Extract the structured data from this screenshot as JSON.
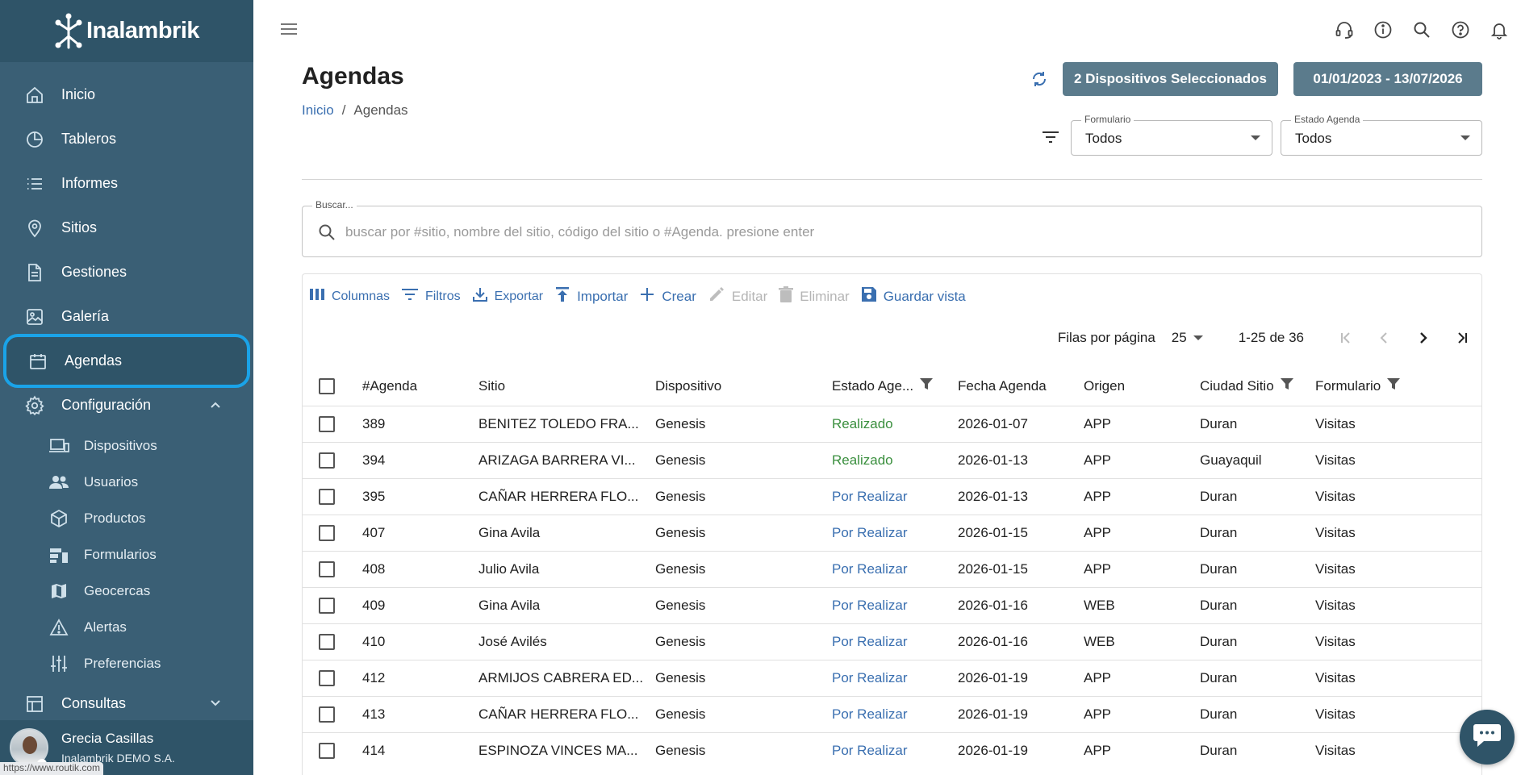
{
  "app": {
    "name": "Inalambrik"
  },
  "sidebar": {
    "items": [
      {
        "label": "Inicio",
        "icon": "home-icon"
      },
      {
        "label": "Tableros",
        "icon": "pie-chart-icon"
      },
      {
        "label": "Informes",
        "icon": "list-icon"
      },
      {
        "label": "Sitios",
        "icon": "location-pin-icon"
      },
      {
        "label": "Gestiones",
        "icon": "document-icon"
      },
      {
        "label": "Galería",
        "icon": "image-icon"
      },
      {
        "label": "Agendas",
        "icon": "calendar-icon",
        "active": true
      },
      {
        "label": "Configuración",
        "icon": "gear-icon",
        "expanded": true
      }
    ],
    "config_items": [
      {
        "label": "Dispositivos",
        "icon": "devices-icon"
      },
      {
        "label": "Usuarios",
        "icon": "users-icon"
      },
      {
        "label": "Productos",
        "icon": "box-icon"
      },
      {
        "label": "Formularios",
        "icon": "form-icon"
      },
      {
        "label": "Geocercas",
        "icon": "map-icon"
      },
      {
        "label": "Alertas",
        "icon": "warning-icon"
      },
      {
        "label": "Preferencias",
        "icon": "sliders-icon"
      }
    ],
    "consultas": {
      "label": "Consultas",
      "icon": "table-icon"
    },
    "user": {
      "name": "Grecia Casillas",
      "company": "Inalambrik DEMO S.A."
    },
    "status_url": "https://www.routik.com"
  },
  "header": {
    "title": "Agendas",
    "breadcrumb": {
      "home": "Inicio",
      "sep": "/",
      "current": "Agendas"
    },
    "devices_button": "2 Dispositivos Seleccionados",
    "dates_button": "01/01/2023 - 13/07/2026",
    "filters": {
      "formulario": {
        "label": "Formulario",
        "value": "Todos"
      },
      "estado": {
        "label": "Estado Agenda",
        "value": "Todos"
      }
    }
  },
  "search": {
    "label": "Buscar...",
    "placeholder": "buscar por #sitio, nombre del sitio, código del sitio o #Agenda. presione enter",
    "value": ""
  },
  "toolbar": {
    "columns": "Columnas",
    "filters": "Filtros",
    "export": "Exportar",
    "import": "Importar",
    "create": "Crear",
    "edit": "Editar",
    "delete": "Eliminar",
    "save_view": "Guardar vista"
  },
  "pager": {
    "rows_per_page_label": "Filas por página",
    "rows_per_page": "25",
    "range": "1-25 de 36"
  },
  "table": {
    "headers": {
      "agenda": "#Agenda",
      "sitio": "Sitio",
      "dispositivo": "Dispositivo",
      "estado": "Estado Age...",
      "fecha": "Fecha Agenda",
      "origen": "Origen",
      "ciudad": "Ciudad Sitio",
      "formulario": "Formulario"
    },
    "rows": [
      {
        "agenda": "389",
        "sitio": "BENITEZ TOLEDO FRA...",
        "dispositivo": "Genesis",
        "estado": "Realizado",
        "fecha": "2026-01-07",
        "origen": "APP",
        "ciudad": "Duran",
        "formulario": "Visitas"
      },
      {
        "agenda": "394",
        "sitio": "ARIZAGA BARRERA VI...",
        "dispositivo": "Genesis",
        "estado": "Realizado",
        "fecha": "2026-01-13",
        "origen": "APP",
        "ciudad": "Guayaquil",
        "formulario": "Visitas"
      },
      {
        "agenda": "395",
        "sitio": "CAÑAR HERRERA FLO...",
        "dispositivo": "Genesis",
        "estado": "Por Realizar",
        "fecha": "2026-01-13",
        "origen": "APP",
        "ciudad": "Duran",
        "formulario": "Visitas"
      },
      {
        "agenda": "407",
        "sitio": "Gina Avila",
        "dispositivo": "Genesis",
        "estado": "Por Realizar",
        "fecha": "2026-01-15",
        "origen": "APP",
        "ciudad": "Duran",
        "formulario": "Visitas"
      },
      {
        "agenda": "408",
        "sitio": "Julio Avila",
        "dispositivo": "Genesis",
        "estado": "Por Realizar",
        "fecha": "2026-01-15",
        "origen": "APP",
        "ciudad": "Duran",
        "formulario": "Visitas"
      },
      {
        "agenda": "409",
        "sitio": "Gina Avila",
        "dispositivo": "Genesis",
        "estado": "Por Realizar",
        "fecha": "2026-01-16",
        "origen": "WEB",
        "ciudad": "Duran",
        "formulario": "Visitas"
      },
      {
        "agenda": "410",
        "sitio": "José Avilés",
        "dispositivo": "Genesis",
        "estado": "Por Realizar",
        "fecha": "2026-01-16",
        "origen": "WEB",
        "ciudad": "Duran",
        "formulario": "Visitas"
      },
      {
        "agenda": "412",
        "sitio": "ARMIJOS CABRERA ED...",
        "dispositivo": "Genesis",
        "estado": "Por Realizar",
        "fecha": "2026-01-19",
        "origen": "APP",
        "ciudad": "Duran",
        "formulario": "Visitas"
      },
      {
        "agenda": "413",
        "sitio": "CAÑAR HERRERA FLO...",
        "dispositivo": "Genesis",
        "estado": "Por Realizar",
        "fecha": "2026-01-19",
        "origen": "APP",
        "ciudad": "Duran",
        "formulario": "Visitas"
      },
      {
        "agenda": "414",
        "sitio": "ESPINOZA VINCES MA...",
        "dispositivo": "Genesis",
        "estado": "Por Realizar",
        "fecha": "2026-01-19",
        "origen": "APP",
        "ciudad": "Duran",
        "formulario": "Visitas"
      }
    ]
  },
  "colors": {
    "sidebar": "#3a5f75",
    "accent": "#1aa3e8",
    "link": "#3a6fb0",
    "done": "#3a8f3e",
    "button": "#5b7b8c"
  }
}
